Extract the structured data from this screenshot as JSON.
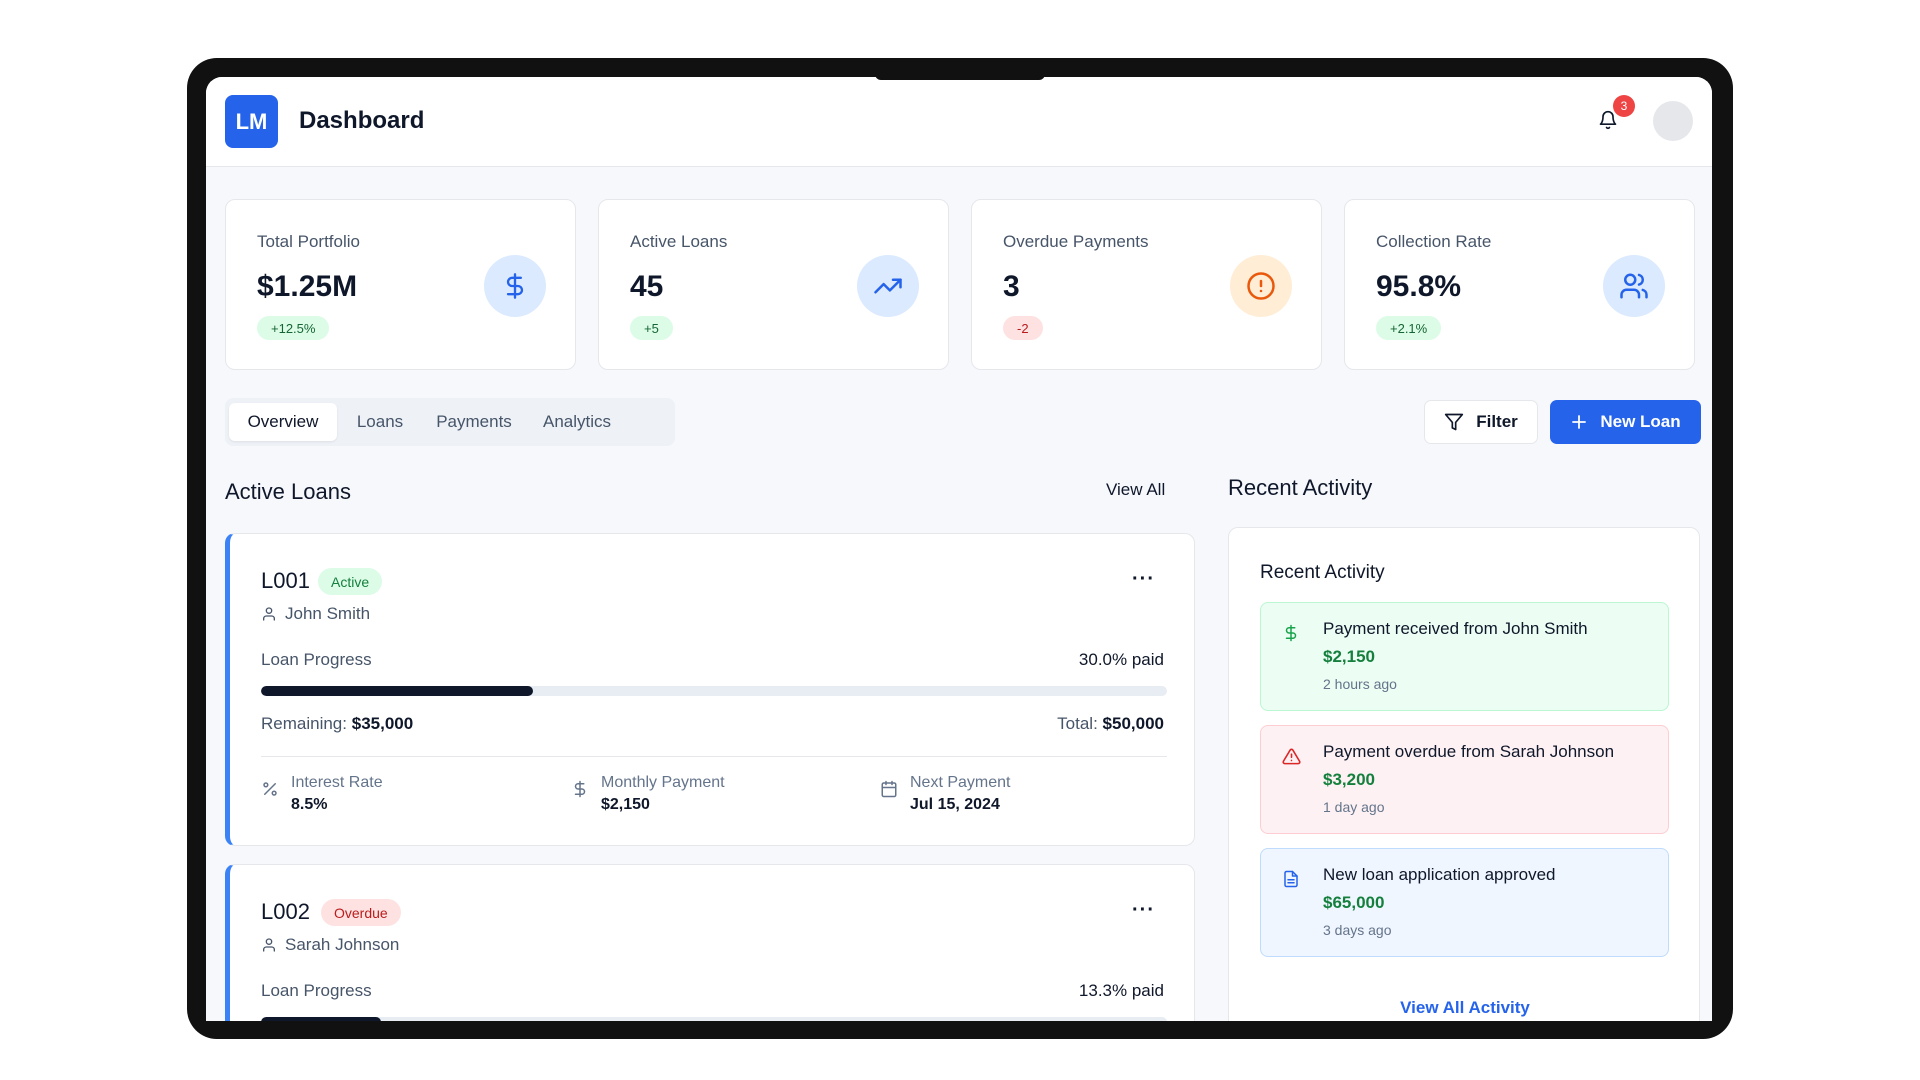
{
  "app": {
    "logo_text": "LM",
    "page_title": "Dashboard"
  },
  "header": {
    "notification_count": "3"
  },
  "stats": [
    {
      "label": "Total Portfolio",
      "value": "$1.25M",
      "delta": "+12.5%",
      "trend": "up",
      "icon": "dollar-icon",
      "icon_bg": "#dbeafe",
      "icon_color": "#2563eb"
    },
    {
      "label": "Active Loans",
      "value": "45",
      "delta": "+5",
      "trend": "up",
      "icon": "trending-up-icon",
      "icon_bg": "#dbeafe",
      "icon_color": "#2563eb"
    },
    {
      "label": "Overdue Payments",
      "value": "3",
      "delta": "-2",
      "trend": "down",
      "icon": "alert-circle-icon",
      "icon_bg": "#ffedd5",
      "icon_color": "#ea580c"
    },
    {
      "label": "Collection Rate",
      "value": "95.8%",
      "delta": "+2.1%",
      "trend": "up",
      "icon": "users-icon",
      "icon_bg": "#dbeafe",
      "icon_color": "#2563eb"
    }
  ],
  "tabs": [
    "Overview",
    "Loans",
    "Payments",
    "Analytics"
  ],
  "active_tab": "Overview",
  "actions": {
    "filter_label": "Filter",
    "new_loan_label": "New Loan"
  },
  "active_loans": {
    "title": "Active Loans",
    "view_all": "View All",
    "loans": [
      {
        "id": "L001",
        "status": "Active",
        "borrower": "John Smith",
        "progress_label": "Loan Progress",
        "progress_text": "30.0% paid",
        "progress": 0.3,
        "remaining_label": "Remaining:",
        "remaining": "$35,000",
        "total_label": "Total:",
        "total": "$50,000",
        "details": [
          {
            "label": "Interest Rate",
            "value": "8.5%",
            "icon": "percent-icon"
          },
          {
            "label": "Monthly Payment",
            "value": "$2,150",
            "icon": "dollar-icon"
          },
          {
            "label": "Next Payment",
            "value": "Jul 15, 2024",
            "icon": "calendar-icon"
          }
        ]
      },
      {
        "id": "L002",
        "status": "Overdue",
        "borrower": "Sarah Johnson",
        "progress_label": "Loan Progress",
        "progress_text": "13.3% paid",
        "progress": 0.133
      }
    ]
  },
  "recent_activity": {
    "section_title": "Recent Activity",
    "panel_title": "Recent Activity",
    "items": [
      {
        "title": "Payment received from John Smith",
        "amount": "$2,150",
        "time": "2 hours ago",
        "icon": "dollar-icon",
        "tone": "success"
      },
      {
        "title": "Payment overdue from Sarah Johnson",
        "amount": "$3,200",
        "time": "1 day ago",
        "icon": "warning-triangle-icon",
        "tone": "danger"
      },
      {
        "title": "New loan application approved",
        "amount": "$65,000",
        "time": "3 days ago",
        "icon": "document-icon",
        "tone": "info"
      }
    ],
    "view_all": "View All Activity"
  }
}
